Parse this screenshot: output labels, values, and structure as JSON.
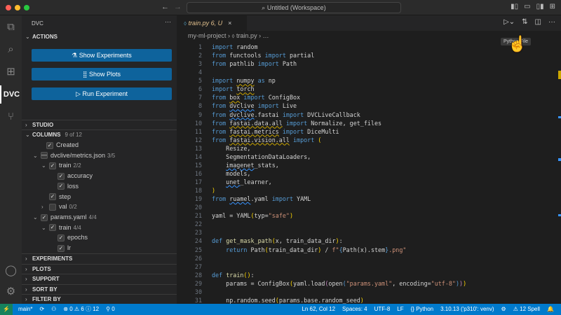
{
  "titlebar": {
    "title": "Untitled (Workspace)",
    "search_icon": "search-icon",
    "back": "←",
    "forward": "→"
  },
  "activity": {
    "items": [
      "explorer",
      "search",
      "extensions",
      "DVC",
      "source-control"
    ],
    "dvc_label": "DVC"
  },
  "sidebar": {
    "title": "DVC",
    "more": "···",
    "actions_label": "ACTIONS",
    "buttons": [
      {
        "icon": "⚗",
        "label": "Show Experiments"
      },
      {
        "icon": "⣿",
        "label": "Show Plots"
      },
      {
        "icon": "▷",
        "label": "Run Experiment"
      }
    ],
    "studio_label": "STUDIO",
    "columns_label": "COLUMNS",
    "columns_count": "9 of 12",
    "columns": [
      {
        "label": "Created",
        "count": "",
        "checked": "✓",
        "chev": ""
      },
      {
        "label": "dvclive/metrics.json",
        "count": "3/5",
        "checked": "—",
        "chev": "⌄"
      },
      {
        "label": "train",
        "count": "2/2",
        "checked": "✓",
        "chev": "⌄"
      },
      {
        "label": "accuracy",
        "count": "",
        "checked": "✓",
        "chev": ""
      },
      {
        "label": "loss",
        "count": "",
        "checked": "✓",
        "chev": ""
      },
      {
        "label": "step",
        "count": "",
        "checked": "✓",
        "chev": ""
      },
      {
        "label": "val",
        "count": "0/2",
        "checked": "",
        "chev": "›"
      },
      {
        "label": "params.yaml",
        "count": "4/4",
        "checked": "✓",
        "chev": "⌄"
      },
      {
        "label": "train",
        "count": "4/4",
        "checked": "✓",
        "chev": "⌄"
      },
      {
        "label": "epochs",
        "count": "",
        "checked": "✓",
        "chev": ""
      },
      {
        "label": "lr",
        "count": "",
        "checked": "✓",
        "chev": ""
      }
    ],
    "sections": [
      "EXPERIMENTS",
      "PLOTS",
      "SUPPORT",
      "SORT BY",
      "FILTER BY"
    ]
  },
  "editor": {
    "tab": {
      "name": "train.py",
      "status": "6, U",
      "close": "×"
    },
    "breadcrumb": "my-ml-project  ›  ⬨ train.py  ›  …",
    "tooltip": "Python File",
    "lines": [
      [
        [
          "k",
          "import"
        ],
        [
          "t",
          " random"
        ]
      ],
      [
        [
          "k",
          "from"
        ],
        [
          "t",
          " functools "
        ],
        [
          "k",
          "import"
        ],
        [
          "t",
          " partial"
        ]
      ],
      [
        [
          "k",
          "from"
        ],
        [
          "t",
          " pathlib "
        ],
        [
          "k",
          "import"
        ],
        [
          "t",
          " Path"
        ]
      ],
      [],
      [
        [
          "k",
          "import"
        ],
        [
          "t",
          " "
        ],
        [
          "w",
          "numpy"
        ],
        [
          "t",
          " "
        ],
        [
          "k",
          "as"
        ],
        [
          "t",
          " np"
        ]
      ],
      [
        [
          "k",
          "import"
        ],
        [
          "t",
          " "
        ],
        [
          "w",
          "torch"
        ]
      ],
      [
        [
          "k",
          "from"
        ],
        [
          "t",
          " "
        ],
        [
          "w",
          "box"
        ],
        [
          "t",
          " "
        ],
        [
          "k",
          "import"
        ],
        [
          "t",
          " ConfigBox"
        ]
      ],
      [
        [
          "k",
          "from"
        ],
        [
          "t",
          " "
        ],
        [
          "b",
          "dvclive"
        ],
        [
          "t",
          " "
        ],
        [
          "k",
          "import"
        ],
        [
          "t",
          " Live"
        ]
      ],
      [
        [
          "k",
          "from"
        ],
        [
          "t",
          " "
        ],
        [
          "b",
          "dvclive"
        ],
        [
          "t",
          ".fastai "
        ],
        [
          "k",
          "import"
        ],
        [
          "t",
          " DVCLiveCallback"
        ]
      ],
      [
        [
          "k",
          "from"
        ],
        [
          "t",
          " "
        ],
        [
          "w",
          "fastai.data.all"
        ],
        [
          "t",
          " "
        ],
        [
          "k",
          "import"
        ],
        [
          "t",
          " Normalize, get_files"
        ]
      ],
      [
        [
          "k",
          "from"
        ],
        [
          "t",
          " "
        ],
        [
          "w",
          "fastai.metrics"
        ],
        [
          "t",
          " "
        ],
        [
          "k",
          "import"
        ],
        [
          "t",
          " DiceMulti"
        ]
      ],
      [
        [
          "k",
          "from"
        ],
        [
          "t",
          " "
        ],
        [
          "w",
          "fastai.vision.all"
        ],
        [
          "t",
          " "
        ],
        [
          "k",
          "import"
        ],
        [
          "t",
          " "
        ],
        [
          "p",
          "("
        ]
      ],
      [
        [
          "t",
          "    Resize,"
        ]
      ],
      [
        [
          "t",
          "    SegmentationDataLoaders,"
        ]
      ],
      [
        [
          "t",
          "    "
        ],
        [
          "b",
          "imagenet"
        ],
        [
          "t",
          "_stats,"
        ]
      ],
      [
        [
          "t",
          "    models,"
        ]
      ],
      [
        [
          "t",
          "    "
        ],
        [
          "b",
          "unet"
        ],
        [
          "t",
          "_learner,"
        ]
      ],
      [
        [
          "p",
          ")"
        ]
      ],
      [
        [
          "k",
          "from"
        ],
        [
          "t",
          " "
        ],
        [
          "b",
          "ruamel"
        ],
        [
          "t",
          ".yaml "
        ],
        [
          "k",
          "import"
        ],
        [
          "t",
          " YAML"
        ]
      ],
      [],
      [
        [
          "t",
          "yaml = YAML"
        ],
        [
          "p",
          "("
        ],
        [
          "t",
          "typ="
        ],
        [
          "s",
          "\"safe\""
        ],
        [
          "p",
          ")"
        ]
      ],
      [],
      [],
      [
        [
          "k",
          "def"
        ],
        [
          "t",
          " "
        ],
        [
          "f",
          "get_mask_path"
        ],
        [
          "p",
          "("
        ],
        [
          "t",
          "x, train_data_dir"
        ],
        [
          "p",
          ")"
        ],
        [
          "t",
          ":"
        ]
      ],
      [
        [
          "t",
          "    "
        ],
        [
          "k",
          "return"
        ],
        [
          "t",
          " Path"
        ],
        [
          "p",
          "("
        ],
        [
          "t",
          "train_data_dir"
        ],
        [
          "p",
          ")"
        ],
        [
          "t",
          " / "
        ],
        [
          "s",
          "f\""
        ],
        [
          "k",
          "{"
        ],
        [
          "t",
          "Path(x).stem"
        ],
        [
          "k",
          "}"
        ],
        [
          "s",
          ".png\""
        ]
      ],
      [],
      [],
      [
        [
          "k",
          "def"
        ],
        [
          "t",
          " "
        ],
        [
          "f",
          "train"
        ],
        [
          "p",
          "()"
        ],
        [
          "t",
          ":"
        ]
      ],
      [
        [
          "t",
          "    params = ConfigBox"
        ],
        [
          "p",
          "("
        ],
        [
          "t",
          "yaml.load"
        ],
        [
          "m",
          "("
        ],
        [
          "t",
          "open"
        ],
        [
          "k",
          "("
        ],
        [
          "s",
          "\"params.yaml\""
        ],
        [
          "t",
          ", encoding="
        ],
        [
          "s",
          "\"utf-8\""
        ],
        [
          "k",
          ")"
        ],
        [
          "m",
          ")"
        ],
        [
          "p",
          ")"
        ]
      ],
      [],
      [
        [
          "t",
          "    np.random.seed"
        ],
        [
          "p",
          "("
        ],
        [
          "t",
          "params.base.random_seed"
        ],
        [
          "p",
          ")"
        ]
      ]
    ]
  },
  "statusbar": {
    "left": [
      "main*",
      "⟳",
      "⚇",
      "⊗ 0  ⚠ 6  ⓘ 12",
      "⚲ 0"
    ],
    "right": [
      "Ln 62, Col 12",
      "Spaces: 4",
      "UTF-8",
      "LF",
      "{} Python",
      "3.10.13 ('p310': venv)",
      "⚙",
      "⚠ 12 Spell",
      "🔔"
    ]
  }
}
